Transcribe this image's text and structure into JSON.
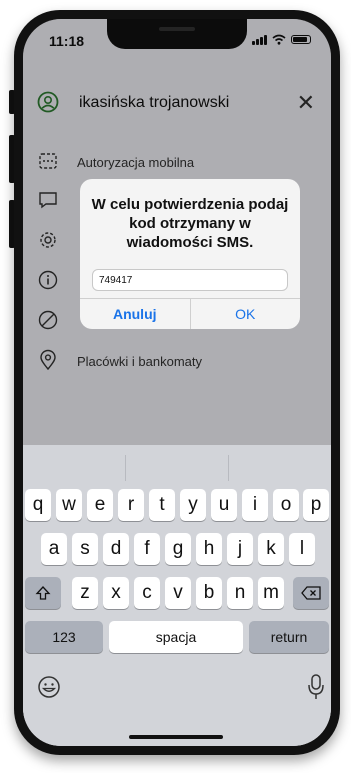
{
  "status_bar": {
    "time": "11:18"
  },
  "header": {
    "user_name": "ikasińska trojanowski"
  },
  "menu": {
    "items": [
      {
        "label": "Autoryzacja mobilna"
      },
      {
        "label": ""
      },
      {
        "label": ""
      },
      {
        "label": ""
      },
      {
        "label": ""
      },
      {
        "label": "Placówki i bankomaty"
      }
    ]
  },
  "dialog": {
    "message": "W celu potwierdzenia podaj kod otrzymany w wiadomości SMS.",
    "input_value": "749417",
    "cancel_label": "Anuluj",
    "ok_label": "OK"
  },
  "keyboard": {
    "row1": [
      "q",
      "w",
      "e",
      "r",
      "t",
      "y",
      "u",
      "i",
      "o",
      "p"
    ],
    "row2": [
      "a",
      "s",
      "d",
      "f",
      "g",
      "h",
      "j",
      "k",
      "l"
    ],
    "row3": [
      "z",
      "x",
      "c",
      "v",
      "b",
      "n",
      "m"
    ],
    "numbers_label": "123",
    "space_label": "spacja",
    "return_label": "return"
  },
  "colors": {
    "accent": "#1a73e8",
    "brand_green": "#2e7d32"
  }
}
